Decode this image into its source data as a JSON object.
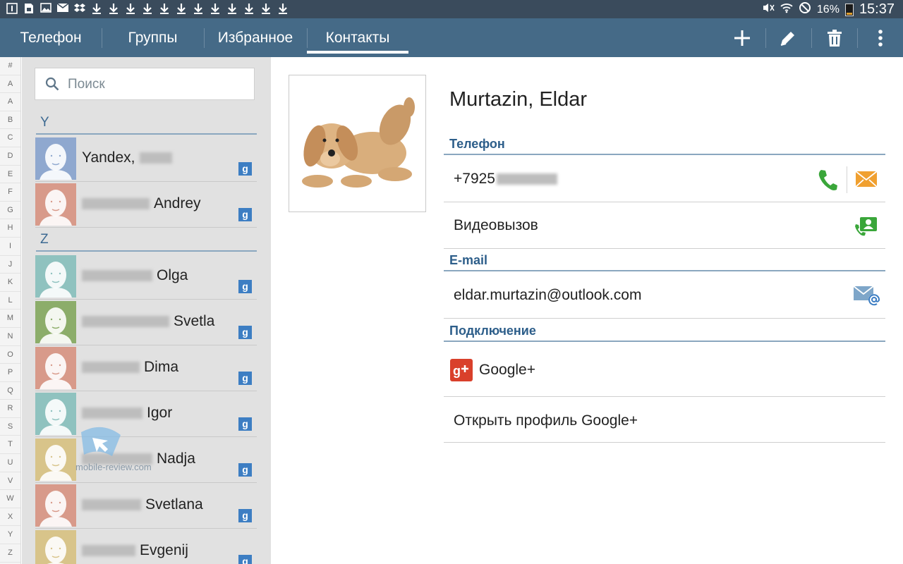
{
  "status_bar": {
    "left_icons": [
      "notification-1-icon",
      "sim-icon",
      "image-icon",
      "gmail-icon",
      "dropbox-icon",
      "download-icon",
      "download-icon",
      "download-icon",
      "download-icon",
      "download-icon",
      "download-icon",
      "download-icon",
      "download-icon",
      "download-icon",
      "download-icon",
      "download-icon",
      "download-icon"
    ],
    "battery_percent": "16%",
    "time": "15:37"
  },
  "tabs": [
    {
      "label": "Телефон",
      "active": false
    },
    {
      "label": "Группы",
      "active": false
    },
    {
      "label": "Избранное",
      "active": false
    },
    {
      "label": "Контакты",
      "active": true
    }
  ],
  "actions": [
    "add-icon",
    "edit-icon",
    "delete-icon",
    "overflow-menu-icon"
  ],
  "index_letters": [
    "#",
    "A",
    "A",
    "B",
    "C",
    "D",
    "E",
    "F",
    "G",
    "H",
    "I",
    "J",
    "K",
    "L",
    "M",
    "N",
    "O",
    "P",
    "Q",
    "R",
    "S",
    "T",
    "U",
    "V",
    "W",
    "X",
    "Y",
    "Z"
  ],
  "search": {
    "placeholder": "Поиск"
  },
  "sections": [
    {
      "letter": "Y"
    },
    {
      "letter": "Z"
    }
  ],
  "contacts": [
    {
      "name": "Yandex,",
      "avatar_color": "#8fa8cf",
      "account": "g"
    },
    {
      "name": "Andrey",
      "avatar_color": "#d89a8a",
      "account": "g"
    },
    {
      "name": "Olga",
      "avatar_color": "#8fc2bf",
      "account": "g"
    },
    {
      "name": "Svetla",
      "avatar_color": "#8cad6a",
      "account": "g"
    },
    {
      "name": "Dima",
      "avatar_color": "#d89a8a",
      "account": "g"
    },
    {
      "name": "Igor",
      "avatar_color": "#8fc2bf",
      "account": "g"
    },
    {
      "name": "Nadja",
      "avatar_color": "#d8c48a",
      "account": "g"
    },
    {
      "name": "Svetlana",
      "avatar_color": "#d89a8a",
      "account": "g"
    },
    {
      "name": "Evgenij",
      "avatar_color": "#d8c48a",
      "account": "g"
    }
  ],
  "watermark": "mobile-review.com",
  "detail": {
    "name": "Murtazin, Eldar",
    "phone_section": "Телефон",
    "phone_number": "+7925",
    "video_call": "Видеовызов",
    "email_section": "E-mail",
    "email": "eldar.murtazin@outlook.com",
    "connection_section": "Подключение",
    "google_plus": "Google+",
    "open_profile": "Открыть профиль Google+"
  },
  "colors": {
    "action_bar": "#456a87",
    "status_bar": "#3a4b5c",
    "accent_text": "#2d5e8a",
    "call_green": "#3aa63a",
    "message_orange": "#f0a030",
    "google_red": "#d9402b"
  }
}
